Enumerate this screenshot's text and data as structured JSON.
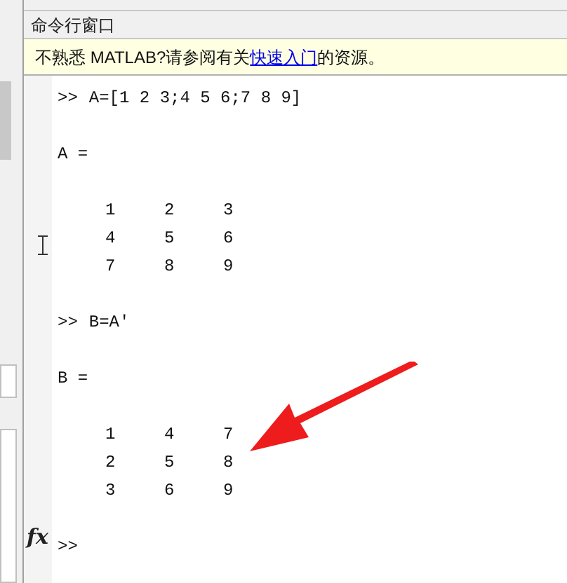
{
  "window": {
    "title": "命令行窗口"
  },
  "notice": {
    "before": "不熟悉 MATLAB?请参阅有关",
    "link": "快速入门",
    "after": "的资源。"
  },
  "lines": [
    {
      "kind": "command",
      "prompt": ">>",
      "text": "A=[1 2 3;4 5 6;7 8 9]"
    },
    {
      "kind": "blank"
    },
    {
      "kind": "label",
      "text": "A ="
    },
    {
      "kind": "blank"
    },
    {
      "kind": "row",
      "cells": [
        "1",
        "2",
        "3"
      ]
    },
    {
      "kind": "row",
      "cells": [
        "4",
        "5",
        "6"
      ]
    },
    {
      "kind": "row",
      "cells": [
        "7",
        "8",
        "9"
      ]
    },
    {
      "kind": "blank"
    },
    {
      "kind": "command",
      "prompt": ">>",
      "text": "B=A'"
    },
    {
      "kind": "blank"
    },
    {
      "kind": "label",
      "text": "B ="
    },
    {
      "kind": "blank"
    },
    {
      "kind": "row",
      "cells": [
        "1",
        "4",
        "7"
      ]
    },
    {
      "kind": "row",
      "cells": [
        "2",
        "5",
        "8"
      ]
    },
    {
      "kind": "row",
      "cells": [
        "3",
        "6",
        "9"
      ]
    },
    {
      "kind": "blank"
    }
  ],
  "input": {
    "prompt": ">>",
    "function_button": "fx"
  }
}
